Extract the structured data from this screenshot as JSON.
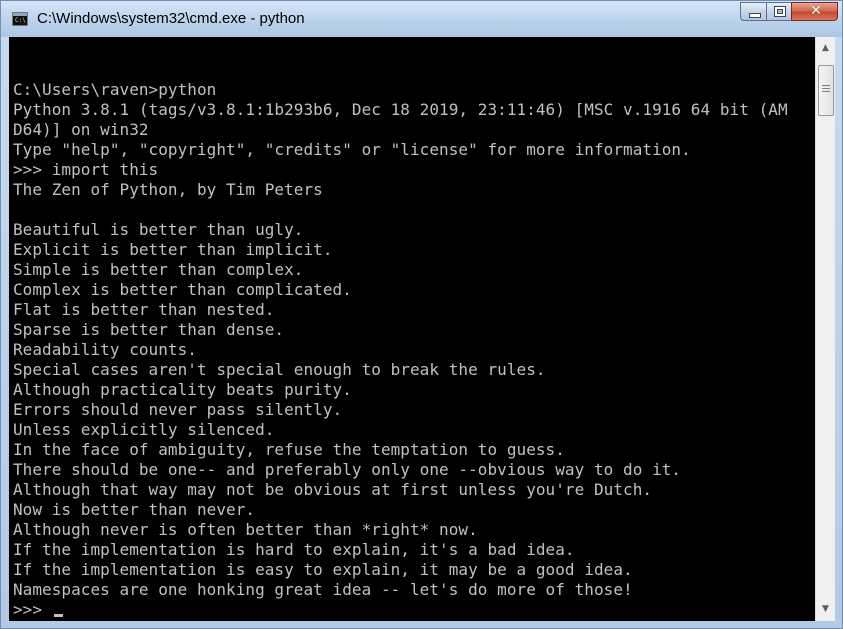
{
  "window": {
    "title": "C:\\Windows\\system32\\cmd.exe - python",
    "app_icon_text": "C:\\"
  },
  "console": {
    "lines": [
      "",
      "C:\\Users\\raven>python",
      "Python 3.8.1 (tags/v3.8.1:1b293b6, Dec 18 2019, 23:11:46) [MSC v.1916 64 bit (AM",
      "D64)] on win32",
      "Type \"help\", \"copyright\", \"credits\" or \"license\" for more information.",
      ">>> import this",
      "The Zen of Python, by Tim Peters",
      "",
      "Beautiful is better than ugly.",
      "Explicit is better than implicit.",
      "Simple is better than complex.",
      "Complex is better than complicated.",
      "Flat is better than nested.",
      "Sparse is better than dense.",
      "Readability counts.",
      "Special cases aren't special enough to break the rules.",
      "Although practicality beats purity.",
      "Errors should never pass silently.",
      "Unless explicitly silenced.",
      "In the face of ambiguity, refuse the temptation to guess.",
      "There should be one-- and preferably only one --obvious way to do it.",
      "Although that way may not be obvious at first unless you're Dutch.",
      "Now is better than never.",
      "Although never is often better than *right* now.",
      "If the implementation is hard to explain, it's a bad idea.",
      "If the implementation is easy to explain, it may be a good idea.",
      "Namespaces are one honking great idea -- let's do more of those!"
    ],
    "prompt": ">>> ",
    "text_color": "#c0c0c0",
    "background_color": "#000000"
  },
  "icons": {
    "app": "console-icon",
    "minimize": "minimize-icon",
    "maximize": "maximize-icon",
    "close": "close-icon",
    "scroll_up": "arrow-up-icon",
    "scroll_down": "arrow-down-icon"
  }
}
